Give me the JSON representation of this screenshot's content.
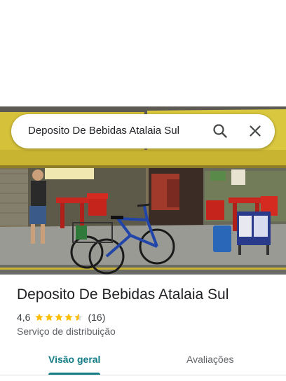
{
  "search": {
    "query": "Deposito De Bebidas Atalaia Sul"
  },
  "place": {
    "name": "Deposito De Bebidas Atalaia Sul",
    "rating": "4,6",
    "rating_fraction": 0.92,
    "review_count": "(16)",
    "category": "Serviço de distribuição"
  },
  "tabs": [
    {
      "label": "Visão geral",
      "active": true
    },
    {
      "label": "Avaliações",
      "active": false
    }
  ],
  "colors": {
    "accent": "#137c85",
    "star": "#fbbc04",
    "awning": "#d6c23a"
  },
  "icons": [
    "search-icon",
    "close-icon",
    "star-icon",
    "star-half-icon"
  ]
}
